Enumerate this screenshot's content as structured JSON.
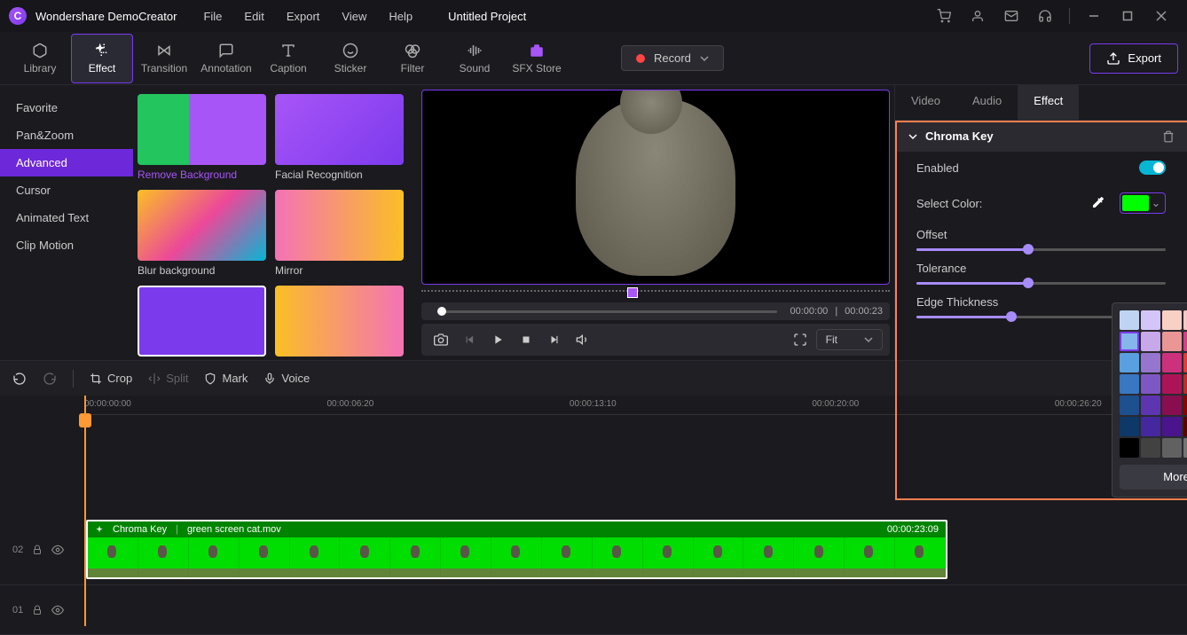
{
  "app": {
    "name": "Wondershare DemoCreator",
    "project": "Untitled Project"
  },
  "menu": [
    "File",
    "Edit",
    "Export",
    "View",
    "Help"
  ],
  "tools": [
    {
      "id": "library",
      "label": "Library"
    },
    {
      "id": "effect",
      "label": "Effect",
      "active": true
    },
    {
      "id": "transition",
      "label": "Transition"
    },
    {
      "id": "annotation",
      "label": "Annotation"
    },
    {
      "id": "caption",
      "label": "Caption"
    },
    {
      "id": "sticker",
      "label": "Sticker"
    },
    {
      "id": "filter",
      "label": "Filter"
    },
    {
      "id": "sound",
      "label": "Sound"
    },
    {
      "id": "sfx",
      "label": "SFX Store"
    }
  ],
  "record": "Record",
  "export": "Export",
  "sidebar": [
    "Favorite",
    "Pan&Zoom",
    "Advanced",
    "Cursor",
    "Animated Text",
    "Clip Motion"
  ],
  "sidebar_active": 2,
  "effects": [
    {
      "label": "Remove Background",
      "active": true
    },
    {
      "label": "Facial Recognition"
    },
    {
      "label": "Blur background"
    },
    {
      "label": "Mirror"
    },
    {
      "label": "",
      "sel": true
    },
    {
      "label": ""
    }
  ],
  "preview": {
    "cur": "00:00:00",
    "total": "00:00:23",
    "fit": "Fit"
  },
  "prop_tabs": [
    "Video",
    "Audio",
    "Effect"
  ],
  "prop_active": 2,
  "chroma": {
    "title": "Chroma Key",
    "enabled": "Enabled",
    "select": "Select Color:",
    "offset": "Offset",
    "tolerance": "Tolerance",
    "edge": "Edge Thickness",
    "color": "#00ff00"
  },
  "picker": {
    "more": "More...",
    "colors": [
      [
        "#bfd4f2",
        "#d4c5f9",
        "#f9d0c4",
        "#f7c6c7",
        "#fad8c7",
        "#fef2c0",
        "#c2e0c6",
        "#bfdadc"
      ],
      [
        "#84b6eb",
        "#c7a8ea",
        "#e99695",
        "#d93f87",
        "#f7a24d",
        "#d4e157",
        "#8bc34a",
        "#4dd0e1"
      ],
      [
        "#5a9fe0",
        "#9575cd",
        "#cc317c",
        "#e53935",
        "#fb8c00",
        "#c0ca33",
        "#7cb342",
        "#26a69a"
      ],
      [
        "#3977c2",
        "#7e57c2",
        "#ad1457",
        "#c62828",
        "#ef6c00",
        "#9e9d24",
        "#558b2f",
        "#00897b"
      ],
      [
        "#1e4f8f",
        "#5e35b1",
        "#880e4f",
        "#8e0000",
        "#bf5700",
        "#827717",
        "#33691e",
        "#00695c"
      ],
      [
        "#0d3868",
        "#4527a0",
        "#4a148c",
        "#5d0000",
        "#6d3b00",
        "#4e4700",
        "#1b5e20",
        "#004d40"
      ],
      [
        "#000000",
        "#424242",
        "#616161",
        "#757575",
        "#9e9e9e",
        "#bdbdbd",
        "#e0e0e0",
        "#ffffff"
      ]
    ]
  },
  "tl_tools": {
    "crop": "Crop",
    "split": "Split",
    "mark": "Mark",
    "voice": "Voice"
  },
  "ruler": [
    {
      "t": "00:00:00:00",
      "p": 0
    },
    {
      "t": "00:00:06:20",
      "p": 22
    },
    {
      "t": "00:00:13:10",
      "p": 44
    },
    {
      "t": "00:00:20:00",
      "p": 66
    },
    {
      "t": "00:00:26:20",
      "p": 88
    }
  ],
  "clip": {
    "effect": "Chroma Key",
    "name": "green screen cat.mov",
    "dur": "00:00:23:09"
  },
  "tracks": {
    "t2": "02",
    "t1": "01"
  }
}
